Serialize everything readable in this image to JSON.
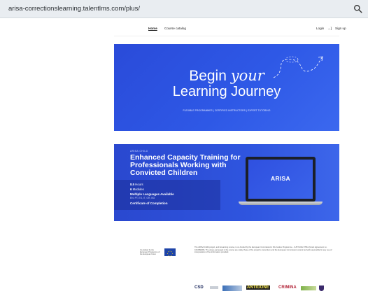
{
  "browser": {
    "url": "arisa-correctionslearning.talentlms.com/plus/",
    "search_icon": "magnifier-icon"
  },
  "nav": {
    "home": "Home",
    "catalog": "Course catalog",
    "login": "Login",
    "login_icon": "→]",
    "signup": "Sign up"
  },
  "hero": {
    "line1_plain": "Begin ",
    "line1_italic": "your",
    "line2": "Learning Journey",
    "tagline": "FLEXIBLE PROGRAMMES | CERTIFIED INSTRUCTORS | EXPERT TUTORING"
  },
  "course": {
    "eyebrow": "ARISA CHILD",
    "title": "Enhanced Capacity Training for Professionals Working with Convicted Children",
    "hours_num": "8.5",
    "hours_label": " Hours",
    "modules_num": "6",
    "modules_label": " Modules",
    "languages": "Multiple Languages Available",
    "languages_list": "EN, PT, ES, IT, GR, BG",
    "certificate": "Certificate of Completion",
    "laptop_logo": "ARISA"
  },
  "footer": {
    "eu_text": "Co-funded by the European Programme of the European Union",
    "disclaimer": "The ARISA CHild project, and E-learning course, is co-funded by the European Commission's DG Justice Programme - JUST-2022 JTRA (Grant Agreement no. 101089466). The views expressed in the course are solely those of the project's consortium and the European Commission cannot be held responsible for any use of interpretation of the information provided.",
    "partners": {
      "csd": "CSD",
      "antigone": "ANTIGONE",
      "crimina": "CRIMINA"
    }
  }
}
